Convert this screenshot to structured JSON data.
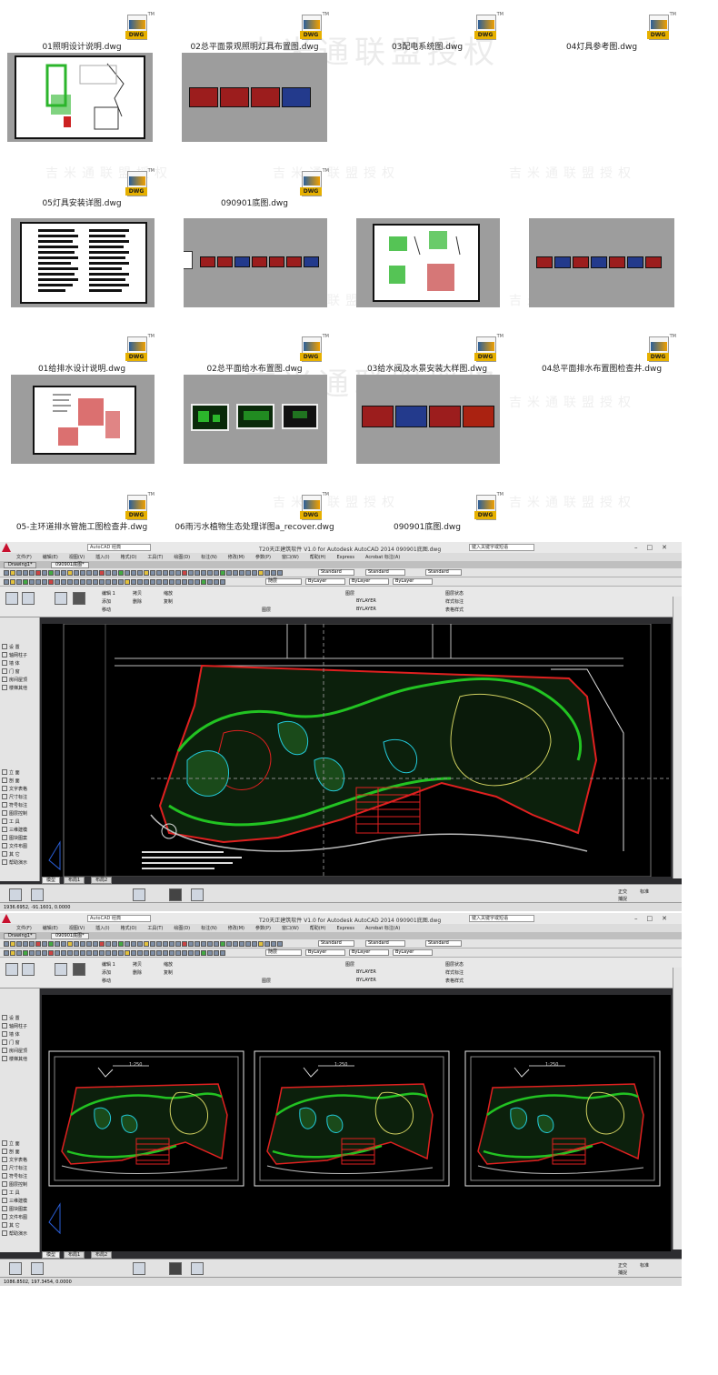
{
  "files": [
    {
      "name": "01照明设计说明.dwg"
    },
    {
      "name": "02总平面景观照明灯具布置图.dwg"
    },
    {
      "name": "03配电系统图.dwg"
    },
    {
      "name": "04灯具参考图.dwg"
    },
    {
      "name": "05灯具安装详图.dwg"
    },
    {
      "name": "090901底图.dwg"
    },
    {
      "name": "01给排水设计说明.dwg"
    },
    {
      "name": "02总平面给水布置图.dwg"
    },
    {
      "name": "03给水阀及水景安装大样图.dwg"
    },
    {
      "name": "04总平面排水布置图检查井.dwg"
    },
    {
      "name": "05-主环道排水管施工图检查井.dwg"
    },
    {
      "name": "06雨污水植物生态处理详图a_recover.dwg"
    },
    {
      "name": "090901底图.dwg"
    }
  ],
  "icon": {
    "badge": "DWG",
    "tm": "TM",
    "icon_name": "dwg-file-icon"
  },
  "watermark": {
    "text": "吉米通联盟授权"
  },
  "acad_windows": [
    {
      "title": "T20天正建筑软件 V1.0 for Autodesk AutoCAD 2014    090901底图.dwg",
      "workspace": "AutoCAD 经典",
      "search_placeholder": "键入关键字或短语",
      "tabs": [
        "Drawing1*",
        "090901底图*"
      ],
      "menu": [
        "文件(F)",
        "编辑(E)",
        "视图(V)",
        "插入(I)",
        "格式(O)",
        "工具(T)",
        "绘图(D)",
        "标注(N)",
        "修改(M)",
        "参数(P)",
        "窗口(W)",
        "帮助(H)",
        "Express",
        "Acrobat 标注(A)"
      ],
      "style_dropdowns": [
        "Standard",
        "Standard",
        "Standard"
      ],
      "layer_dropdowns": [
        "ByLayer",
        "ByLayer",
        "ByLayer"
      ],
      "color_dropdown": "随层",
      "ribbon_labels": [
        "编辑 1",
        "添加",
        "移动",
        "拷贝",
        "删除",
        "缩放",
        "复制",
        "图层",
        "BYLAYER",
        "BYLAYER",
        "图层状态",
        "样式标注",
        "表格样式",
        "图层"
      ],
      "left_panel": [
        "设 置",
        "轴网柱子",
        "墙 体",
        "门 窗",
        "房间屋顶",
        "楼梯其他",
        "立 面",
        "剖 面",
        "文字表格",
        "尺寸标注",
        "符号标注",
        "图层控制",
        "工 具",
        "三维建模",
        "图块图案",
        "文件布图",
        "其 它",
        "帮助演示"
      ],
      "drawing_tabs": [
        "模型",
        "布局1",
        "布局2"
      ],
      "coords": "1936.6952, -91.1601, 0.0000",
      "right_status": [
        "正交",
        "捕捉",
        "标准"
      ]
    },
    {
      "title": "T20天正建筑软件 V1.0 for Autodesk AutoCAD 2014    090901底图.dwg",
      "workspace": "AutoCAD 经典",
      "search_placeholder": "键入关键字或短语",
      "tabs": [
        "Drawing1*",
        "090901底图*"
      ],
      "menu": [
        "文件(F)",
        "编辑(E)",
        "视图(V)",
        "插入(I)",
        "格式(O)",
        "工具(T)",
        "绘图(D)",
        "标注(N)",
        "修改(M)",
        "参数(P)",
        "窗口(W)",
        "帮助(H)",
        "Express",
        "Acrobat 标注(A)"
      ],
      "style_dropdowns": [
        "Standard",
        "Standard",
        "Standard"
      ],
      "layer_dropdowns": [
        "ByLayer",
        "ByLayer",
        "ByLayer"
      ],
      "color_dropdown": "随层",
      "ribbon_labels": [
        "编辑 1",
        "添加",
        "移动",
        "拷贝",
        "删除",
        "缩放",
        "复制",
        "图层",
        "BYLAYER",
        "BYLAYER",
        "图层状态",
        "样式标注",
        "表格样式",
        "图层"
      ],
      "left_panel": [
        "设 置",
        "轴网柱子",
        "墙 体",
        "门 窗",
        "房间屋顶",
        "楼梯其他",
        "立 面",
        "剖 面",
        "文字表格",
        "尺寸标注",
        "符号标注",
        "图层控制",
        "工 具",
        "三维建模",
        "图块图案",
        "文件布图",
        "其 它",
        "帮助演示"
      ],
      "drawing_tabs": [
        "模型",
        "布局1",
        "布局2"
      ],
      "coords": "1086.8502, 197.3454, 0.0000",
      "right_status": [
        "正交",
        "捕捉",
        "标准"
      ],
      "sheet_labels": [
        "1:250",
        "1:250",
        "1:250"
      ]
    }
  ],
  "colors": {
    "canvas": "#000000",
    "thumb_bg": "#9d9d9d",
    "cad_green": "#22c322",
    "cad_red": "#e02020",
    "cad_cyan": "#22c8d8"
  }
}
